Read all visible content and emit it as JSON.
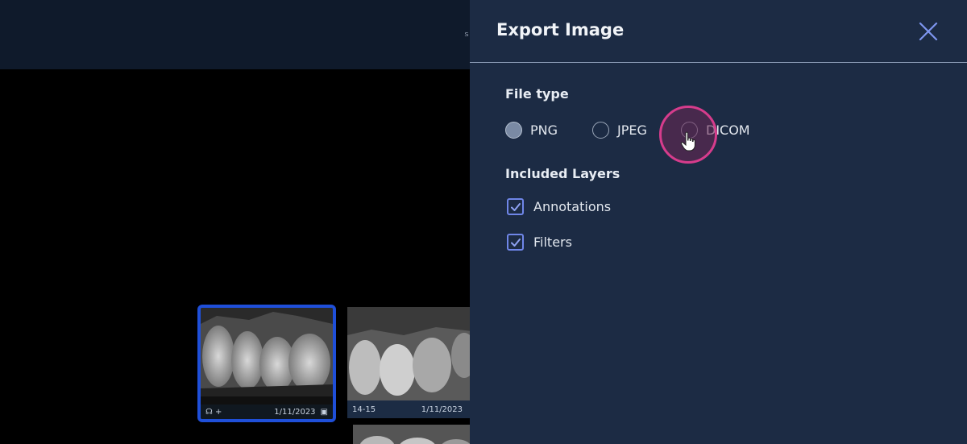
{
  "background": {
    "header_glyph": "ₛ",
    "thumbnails": [
      {
        "tooth": "",
        "date": "1/11/2023"
      },
      {
        "tooth": "14-15",
        "date": "1/11/2023"
      }
    ]
  },
  "export_panel": {
    "title": "Export Image",
    "file_type": {
      "label": "File type",
      "options": [
        {
          "label": "PNG",
          "selected": true
        },
        {
          "label": "JPEG",
          "selected": false
        },
        {
          "label": "DICOM",
          "selected": false
        }
      ]
    },
    "layers": {
      "label": "Included Layers",
      "items": [
        {
          "label": "Annotations",
          "checked": true
        },
        {
          "label": "Filters",
          "checked": true
        }
      ]
    }
  },
  "colors": {
    "panel_bg": "#1c2b44",
    "accent": "#6f86e8",
    "selection_border": "#1f4fd8",
    "highlight": "#d63c8c"
  }
}
